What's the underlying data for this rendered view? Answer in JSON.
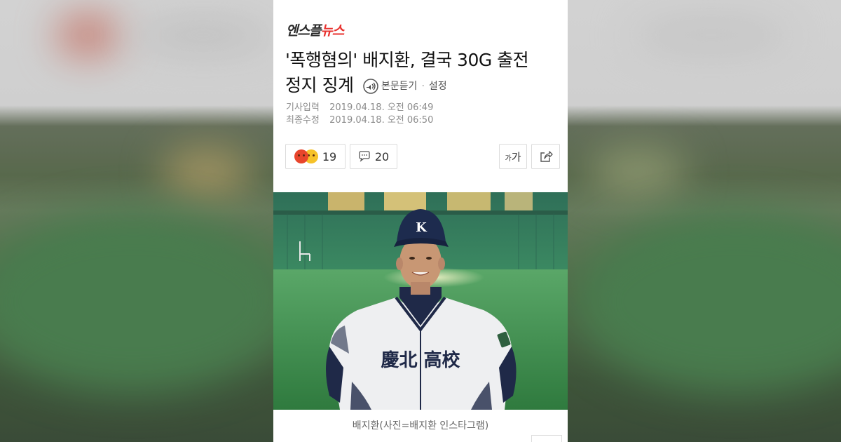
{
  "publisher": {
    "logo_part1": "엔스플",
    "logo_part2": "뉴스"
  },
  "article": {
    "headline_line1": "'폭행혐의' 배지환, 결국 30G 출전",
    "headline_line2": "정지 징계",
    "tts_label": "본문듣기",
    "tts_separator": "·",
    "settings_label": "설정",
    "published_label": "기사입력",
    "published_value": "2019.04.18. 오전 06:49",
    "modified_label": "최종수정",
    "modified_value": "2019.04.18. 오전 06:50"
  },
  "actions": {
    "reaction_count": "19",
    "comment_count": "20",
    "font_size_label": "가",
    "font_size_small": "가"
  },
  "photo": {
    "caption": "배지환(사진=배지환 인스타그램)",
    "cap_letter": "K",
    "jersey_text": "慶北 高校"
  },
  "colors": {
    "brand_red": "#e8322f",
    "angry_emoji": "#e8452c",
    "laugh_emoji": "#f6c229"
  },
  "icons": [
    "speaker-icon",
    "angry-emoji-icon",
    "laugh-emoji-icon",
    "comment-icon",
    "font-size-icon",
    "share-icon"
  ]
}
